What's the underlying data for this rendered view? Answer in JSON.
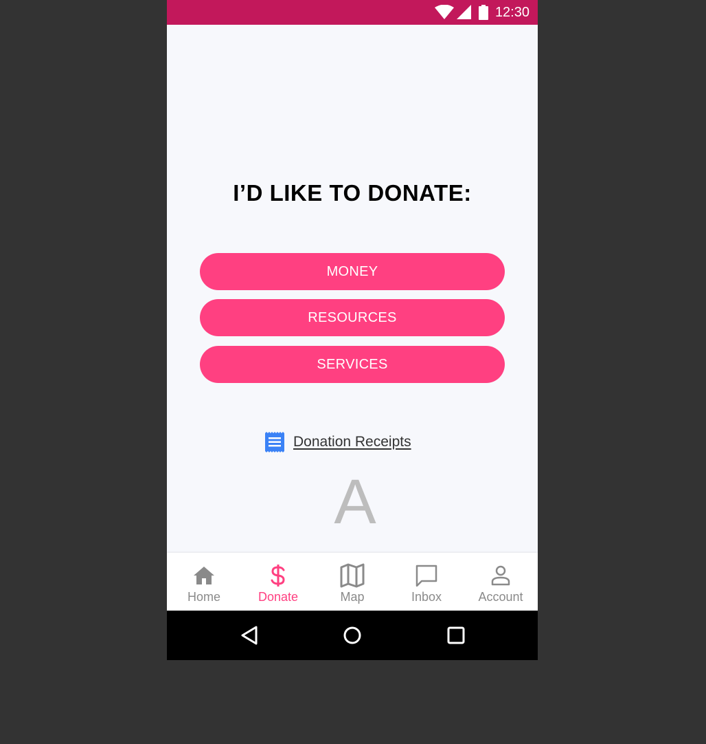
{
  "status_bar": {
    "time": "12:30",
    "background_color": "#c2185b",
    "icons": [
      "wifi-icon",
      "signal-icon",
      "battery-icon"
    ]
  },
  "main": {
    "heading": "I’D LIKE TO DONATE:",
    "options": [
      {
        "label": "MONEY"
      },
      {
        "label": "RESOURCES"
      },
      {
        "label": "SERVICES"
      }
    ],
    "button_color": "#ff4081",
    "receipts_link": {
      "label": "Donation Receipts",
      "icon": "receipt-icon",
      "icon_color": "#3b82f6"
    },
    "watermark_letter": "A"
  },
  "bottom_nav": {
    "active_color": "#ff4081",
    "inactive_color": "#8a8a8a",
    "items": [
      {
        "label": "Home",
        "icon": "home-icon",
        "active": false
      },
      {
        "label": "Donate",
        "icon": "dollar-icon",
        "active": true
      },
      {
        "label": "Map",
        "icon": "map-icon",
        "active": false
      },
      {
        "label": "Inbox",
        "icon": "chat-icon",
        "active": false
      },
      {
        "label": "Account",
        "icon": "person-icon",
        "active": false
      }
    ]
  },
  "system_nav": {
    "icons": [
      "back-icon",
      "home-circle-icon",
      "recents-icon"
    ]
  }
}
